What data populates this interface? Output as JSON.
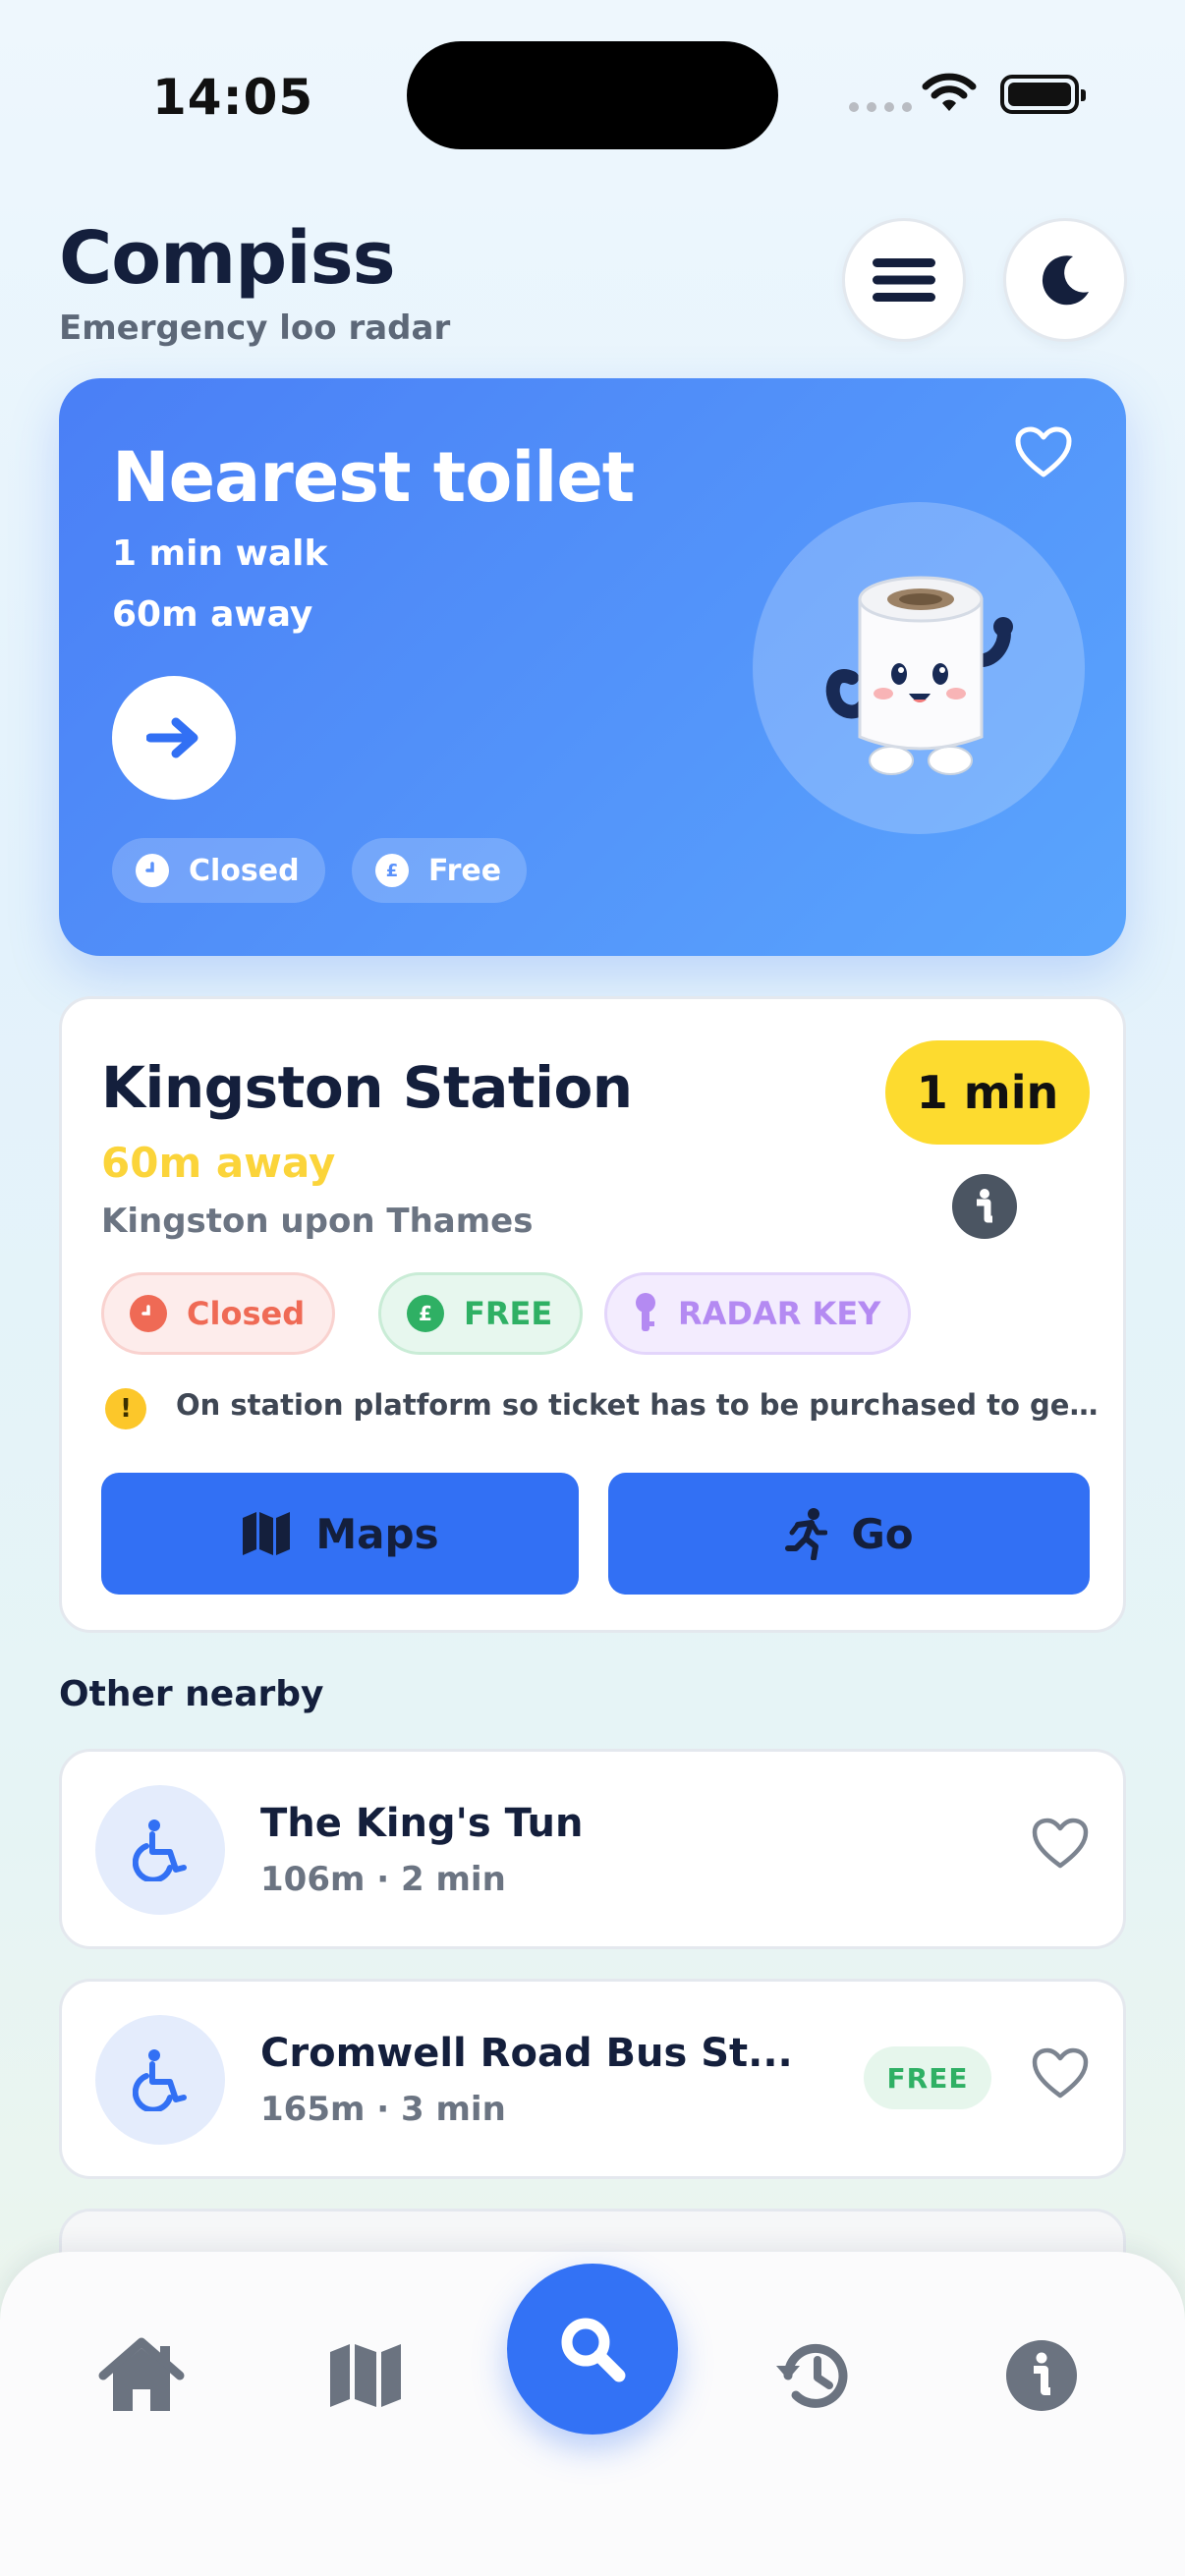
{
  "status_bar": {
    "time": "14:05"
  },
  "header": {
    "title": "Compiss",
    "subtitle": "Emergency loo radar",
    "menu_icon": "hamburger-menu-icon",
    "theme_icon": "moon-icon"
  },
  "hero": {
    "title": "Nearest toilet",
    "walk": "1 min walk",
    "distance": "60m away",
    "chip_status": "Closed",
    "chip_price": "Free",
    "price_symbol": "£",
    "accent": "#4a7ff6"
  },
  "detail": {
    "name": "Kingston Station",
    "distance": "60m away",
    "area": "Kingston upon Thames",
    "time_badge": "1 min",
    "tags": {
      "status": "Closed",
      "price": "FREE",
      "access": "RADAR KEY",
      "price_symbol": "£"
    },
    "note_mark": "!",
    "note": "On station platform so ticket has to be purchased to get through",
    "maps_label": "Maps",
    "go_label": "Go"
  },
  "nearby": {
    "title": "Other nearby",
    "items": [
      {
        "name": "The King's Tun",
        "meta": "106m · 2 min",
        "tag": ""
      },
      {
        "name": "Cromwell Road Bus St...",
        "meta": "165m · 3 min",
        "tag": "FREE"
      }
    ]
  },
  "tabbar": {
    "items": [
      "home-icon",
      "map-icon",
      "search-icon",
      "history-icon",
      "info-icon"
    ]
  },
  "colors": {
    "primary": "#3270f4",
    "yellow": "#fddb2f",
    "closed": "#ef6a55",
    "free": "#2fb064",
    "radar": "#b48af2",
    "navy": "#141f3c"
  }
}
